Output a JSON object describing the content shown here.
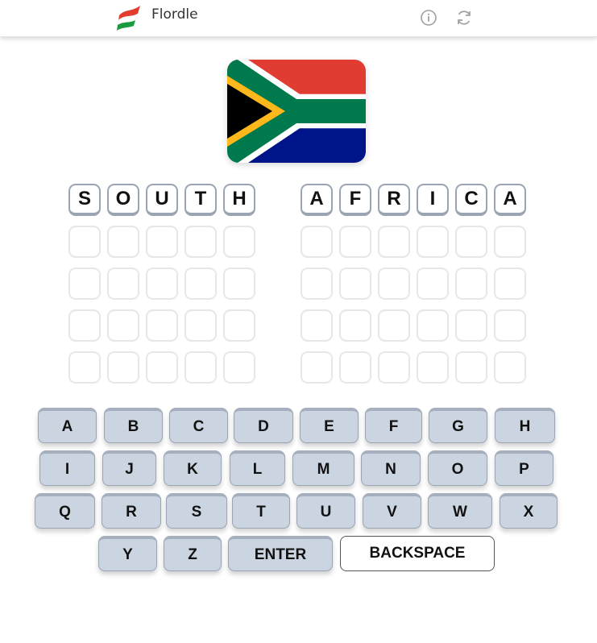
{
  "app": {
    "title": "Flordle",
    "icons": {
      "logo": "flordle-flag-logo",
      "info": "info-icon",
      "refresh": "refresh-icon"
    }
  },
  "flag": {
    "country": "South Africa",
    "icon": "south-africa-flag"
  },
  "answer": {
    "words": [
      {
        "letters": [
          "S",
          "O",
          "U",
          "T",
          "H"
        ]
      },
      {
        "letters": [
          "A",
          "F",
          "R",
          "I",
          "C",
          "A"
        ]
      }
    ]
  },
  "empty_guess_rows": 4,
  "keyboard": {
    "rows": [
      [
        "A",
        "B",
        "C",
        "D",
        "E",
        "F",
        "G",
        "H"
      ],
      [
        "I",
        "J",
        "K",
        "L",
        "M",
        "N",
        "O",
        "P"
      ],
      [
        "Q",
        "R",
        "S",
        "T",
        "U",
        "V",
        "W",
        "X"
      ],
      [
        "Y",
        "Z",
        "ENTER",
        "BACKSPACE"
      ]
    ]
  },
  "colors": {
    "key_bg": "#cbd5e1",
    "cell_border": "#e5e7eb",
    "filled_border": "#9aa4b2",
    "flag_red": "#e03c31",
    "flag_green": "#007a4d",
    "flag_blue": "#001489",
    "flag_gold": "#ffb81c"
  }
}
